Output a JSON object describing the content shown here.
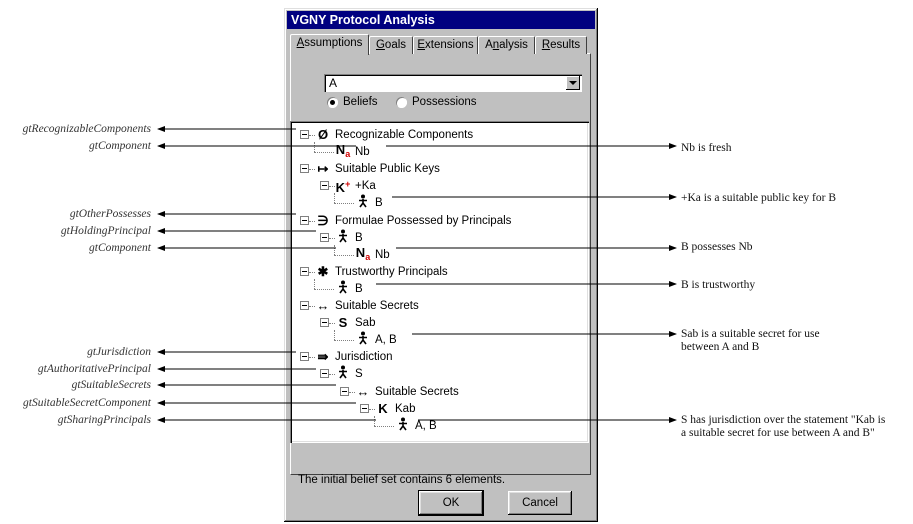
{
  "dialog": {
    "title": "VGNY Protocol Analysis",
    "tabs": [
      {
        "pre": "",
        "u": "A",
        "post": "ssumptions"
      },
      {
        "pre": "",
        "u": "G",
        "post": "oals"
      },
      {
        "pre": "",
        "u": "E",
        "post": "xtensions"
      },
      {
        "pre": "A",
        "u": "n",
        "post": "alysis"
      },
      {
        "pre": "",
        "u": "R",
        "post": "esults"
      }
    ],
    "combo_value": "A",
    "radio_beliefs": "Beliefs",
    "radio_possessions": "Possessions",
    "status": "The initial belief set contains 6 elements.",
    "ok": "OK",
    "cancel": "Cancel"
  },
  "tree": [
    {
      "icon": "Ø",
      "label": "Recognizable Components"
    },
    {
      "icon": "N",
      "label": "Nb"
    },
    {
      "icon": "↦",
      "label": "Suitable Public Keys"
    },
    {
      "icon": "K",
      "label": "+Ka"
    },
    {
      "icon": "person",
      "label": "B"
    },
    {
      "icon": "∋",
      "label": "Formulae Possessed by Principals"
    },
    {
      "icon": "person",
      "label": "B"
    },
    {
      "icon": "N",
      "label": "Nb"
    },
    {
      "icon": "✱",
      "label": "Trustworthy Principals"
    },
    {
      "icon": "person",
      "label": "B"
    },
    {
      "icon": "↔",
      "label": "Suitable Secrets"
    },
    {
      "icon": "S",
      "label": "Sab"
    },
    {
      "icon": "person",
      "label": "A, B"
    },
    {
      "icon": "⇛",
      "label": "Jurisdiction"
    },
    {
      "icon": "person",
      "label": "S"
    },
    {
      "icon": "↔",
      "label": "Suitable Secrets"
    },
    {
      "icon": "K",
      "label": "Kab"
    },
    {
      "icon": "person",
      "label": "A, B"
    }
  ],
  "annotations_left": [
    "gtRecognizableComponents",
    "gtComponent",
    "gtOtherPossesses",
    "gtHoldingPrincipal",
    "gtComponent",
    "gtJurisdiction",
    "gtAuthoritativePrincipal",
    "gtSuitableSecrets",
    "gtSuitableSecretComponent",
    "gtSharingPrincipals"
  ],
  "annotations_right": [
    "Nb is fresh",
    "+Ka is a suitable public key for B",
    "B possesses Nb",
    "B is trustworthy",
    "Sab is a suitable secret for use",
    "between A and B",
    "S has jurisdiction over the statement \"Kab is",
    "a suitable secret for use between A and B\""
  ]
}
